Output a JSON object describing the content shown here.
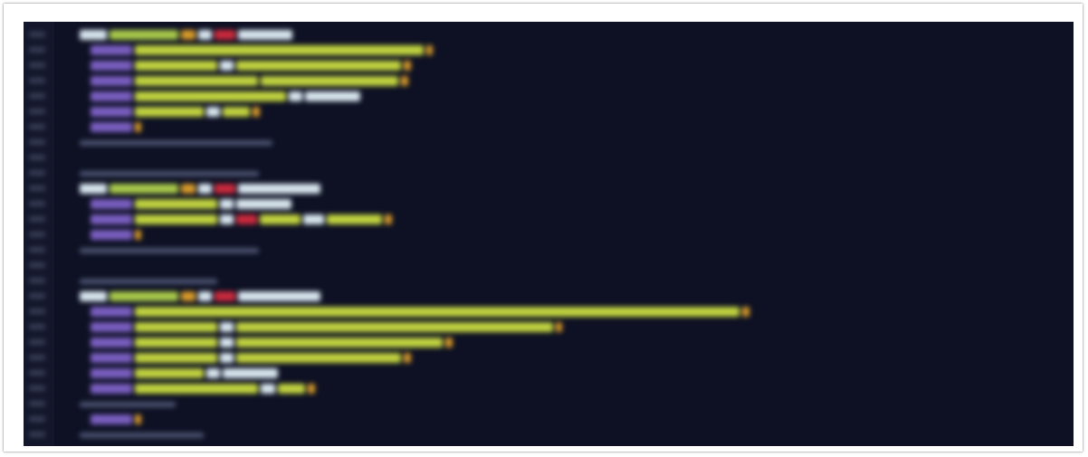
{
  "editor": {
    "colors": {
      "background": "#0e1124",
      "gutter": "#14172b",
      "line_number": "#3a3f57",
      "keyword": "#d8e6ef",
      "identifier": "#a8c94a",
      "type": "#c92a3c",
      "property": "#7a5fc0",
      "string": "#c2d33f",
      "bracket": "#d79a2a",
      "comment": "#4c5370"
    },
    "lines": [
      [
        [
          "keyword",
          4
        ],
        [
          "identifier",
          10
        ],
        [
          "bracket",
          2
        ],
        [
          "keyword",
          2
        ],
        [
          "type",
          3
        ],
        [
          "keyword",
          8
        ]
      ],
      [
        [
          "property",
          6
        ],
        [
          "string",
          42
        ],
        [
          "bracket",
          1
        ]
      ],
      [
        [
          "property",
          6
        ],
        [
          "string",
          12
        ],
        [
          "keyword",
          2
        ],
        [
          "string",
          24
        ],
        [
          "bracket",
          1
        ]
      ],
      [
        [
          "property",
          6
        ],
        [
          "string",
          18
        ],
        [
          "string",
          20
        ],
        [
          "bracket",
          1
        ]
      ],
      [
        [
          "property",
          6
        ],
        [
          "string",
          22
        ],
        [
          "keyword",
          2
        ],
        [
          "keyword",
          8
        ]
      ],
      [
        [
          "property",
          6
        ],
        [
          "string",
          10
        ],
        [
          "keyword",
          2
        ],
        [
          "string",
          4
        ],
        [
          "bracket",
          1
        ]
      ],
      [
        [
          "property",
          6
        ],
        [
          "bracket",
          1
        ]
      ],
      [
        [
          "comment",
          28
        ]
      ],
      [],
      [
        [
          "comment",
          26
        ]
      ],
      [
        [
          "keyword",
          4
        ],
        [
          "identifier",
          10
        ],
        [
          "bracket",
          2
        ],
        [
          "keyword",
          2
        ],
        [
          "type",
          3
        ],
        [
          "keyword",
          12
        ]
      ],
      [
        [
          "property",
          6
        ],
        [
          "string",
          12
        ],
        [
          "keyword",
          2
        ],
        [
          "keyword",
          8
        ]
      ],
      [
        [
          "property",
          6
        ],
        [
          "string",
          12
        ],
        [
          "keyword",
          2
        ],
        [
          "type",
          3
        ],
        [
          "string",
          6
        ],
        [
          "keyword",
          3
        ],
        [
          "string",
          8
        ],
        [
          "bracket",
          1
        ]
      ],
      [
        [
          "property",
          6
        ],
        [
          "bracket",
          1
        ]
      ],
      [
        [
          "comment",
          26
        ]
      ],
      [],
      [
        [
          "comment",
          20
        ]
      ],
      [
        [
          "keyword",
          4
        ],
        [
          "identifier",
          10
        ],
        [
          "bracket",
          2
        ],
        [
          "keyword",
          2
        ],
        [
          "type",
          3
        ],
        [
          "keyword",
          12
        ]
      ],
      [
        [
          "property",
          6
        ],
        [
          "string",
          88
        ],
        [
          "bracket",
          1
        ]
      ],
      [
        [
          "property",
          6
        ],
        [
          "string",
          12
        ],
        [
          "keyword",
          2
        ],
        [
          "string",
          46
        ],
        [
          "bracket",
          1
        ]
      ],
      [
        [
          "property",
          6
        ],
        [
          "string",
          12
        ],
        [
          "keyword",
          2
        ],
        [
          "string",
          30
        ],
        [
          "bracket",
          1
        ]
      ],
      [
        [
          "property",
          6
        ],
        [
          "string",
          12
        ],
        [
          "keyword",
          2
        ],
        [
          "string",
          24
        ],
        [
          "bracket",
          1
        ]
      ],
      [
        [
          "property",
          6
        ],
        [
          "string",
          10
        ],
        [
          "keyword",
          2
        ],
        [
          "keyword",
          8
        ]
      ],
      [
        [
          "property",
          6
        ],
        [
          "string",
          18
        ],
        [
          "keyword",
          2
        ],
        [
          "string",
          4
        ],
        [
          "bracket",
          1
        ]
      ],
      [
        [
          "comment",
          14
        ]
      ],
      [
        [
          "property",
          6
        ],
        [
          "bracket",
          1
        ]
      ],
      [
        [
          "comment",
          18
        ]
      ]
    ]
  }
}
